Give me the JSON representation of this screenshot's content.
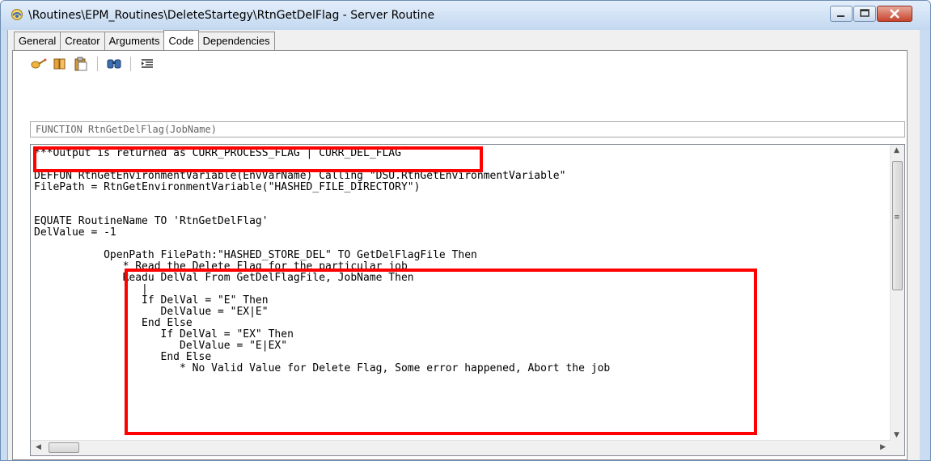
{
  "window": {
    "title": "\\Routines\\EPM_Routines\\DeleteStartegy\\RtnGetDelFlag - Server Routine",
    "controls": [
      "minimize",
      "maximize",
      "close"
    ]
  },
  "tabs": [
    {
      "label": "General",
      "active": false
    },
    {
      "label": "Creator",
      "active": false
    },
    {
      "label": "Arguments",
      "active": false
    },
    {
      "label": "Code",
      "active": true
    },
    {
      "label": "Dependencies",
      "active": false
    }
  ],
  "toolbar": {
    "icons": [
      "insert-icon",
      "book-icon",
      "clipboard-icon",
      "find-icon",
      "format-icon"
    ]
  },
  "function_signature": "FUNCTION RtnGetDelFlag(JobName)",
  "code": {
    "lines": [
      "***Output is returned as CURR_PROCESS_FLAG | CURR_DEL_FLAG",
      "",
      "DEFFUN RtnGetEnvironmentVariable(EnvVarName) Calling \"DSU.RtnGetEnvironmentVariable\"",
      "FilePath = RtnGetEnvironmentVariable(\"HASHED_FILE_DIRECTORY\")",
      "",
      "",
      "EQUATE RoutineName TO 'RtnGetDelFlag'",
      "DelValue = -1",
      "",
      "           OpenPath FilePath:\"HASHED_STORE_DEL\" TO GetDelFlagFile Then",
      "              * Read the Delete Flag for the particular job",
      "              Readu DelVal From GetDelFlagFile, JobName Then",
      "                 |",
      "                 If DelVal = \"E\" Then",
      "                    DelValue = \"EX|E\"",
      "                 End Else",
      "                    If DelVal = \"EX\" Then",
      "                       DelValue = \"E|EX\"",
      "                    End Else",
      "                       * No Valid Value for Delete Flag, Some error happened, Abort the job"
    ]
  },
  "highlight_color": "#ff0000"
}
